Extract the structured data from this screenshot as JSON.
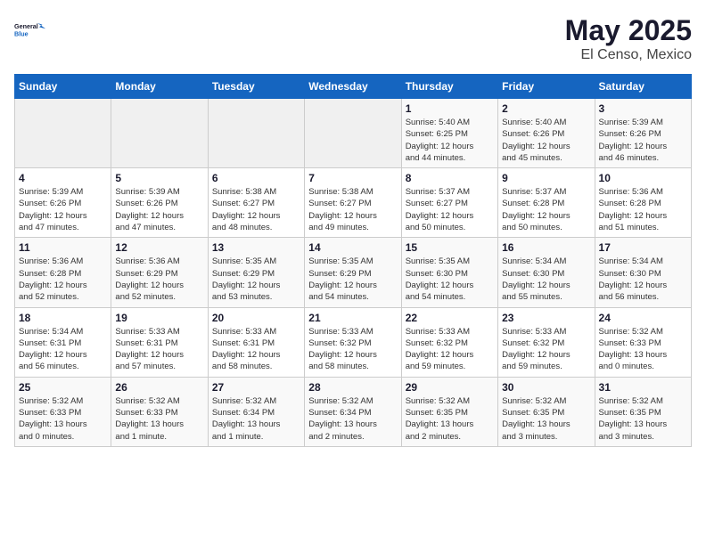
{
  "logo": {
    "line1": "General",
    "line2": "Blue"
  },
  "calendar": {
    "title": "May 2025",
    "subtitle": "El Censo, Mexico"
  },
  "weekdays": [
    "Sunday",
    "Monday",
    "Tuesday",
    "Wednesday",
    "Thursday",
    "Friday",
    "Saturday"
  ],
  "weeks": [
    [
      {
        "day": "",
        "info": ""
      },
      {
        "day": "",
        "info": ""
      },
      {
        "day": "",
        "info": ""
      },
      {
        "day": "",
        "info": ""
      },
      {
        "day": "1",
        "info": "Sunrise: 5:40 AM\nSunset: 6:25 PM\nDaylight: 12 hours\nand 44 minutes."
      },
      {
        "day": "2",
        "info": "Sunrise: 5:40 AM\nSunset: 6:26 PM\nDaylight: 12 hours\nand 45 minutes."
      },
      {
        "day": "3",
        "info": "Sunrise: 5:39 AM\nSunset: 6:26 PM\nDaylight: 12 hours\nand 46 minutes."
      }
    ],
    [
      {
        "day": "4",
        "info": "Sunrise: 5:39 AM\nSunset: 6:26 PM\nDaylight: 12 hours\nand 47 minutes."
      },
      {
        "day": "5",
        "info": "Sunrise: 5:39 AM\nSunset: 6:26 PM\nDaylight: 12 hours\nand 47 minutes."
      },
      {
        "day": "6",
        "info": "Sunrise: 5:38 AM\nSunset: 6:27 PM\nDaylight: 12 hours\nand 48 minutes."
      },
      {
        "day": "7",
        "info": "Sunrise: 5:38 AM\nSunset: 6:27 PM\nDaylight: 12 hours\nand 49 minutes."
      },
      {
        "day": "8",
        "info": "Sunrise: 5:37 AM\nSunset: 6:27 PM\nDaylight: 12 hours\nand 50 minutes."
      },
      {
        "day": "9",
        "info": "Sunrise: 5:37 AM\nSunset: 6:28 PM\nDaylight: 12 hours\nand 50 minutes."
      },
      {
        "day": "10",
        "info": "Sunrise: 5:36 AM\nSunset: 6:28 PM\nDaylight: 12 hours\nand 51 minutes."
      }
    ],
    [
      {
        "day": "11",
        "info": "Sunrise: 5:36 AM\nSunset: 6:28 PM\nDaylight: 12 hours\nand 52 minutes."
      },
      {
        "day": "12",
        "info": "Sunrise: 5:36 AM\nSunset: 6:29 PM\nDaylight: 12 hours\nand 52 minutes."
      },
      {
        "day": "13",
        "info": "Sunrise: 5:35 AM\nSunset: 6:29 PM\nDaylight: 12 hours\nand 53 minutes."
      },
      {
        "day": "14",
        "info": "Sunrise: 5:35 AM\nSunset: 6:29 PM\nDaylight: 12 hours\nand 54 minutes."
      },
      {
        "day": "15",
        "info": "Sunrise: 5:35 AM\nSunset: 6:30 PM\nDaylight: 12 hours\nand 54 minutes."
      },
      {
        "day": "16",
        "info": "Sunrise: 5:34 AM\nSunset: 6:30 PM\nDaylight: 12 hours\nand 55 minutes."
      },
      {
        "day": "17",
        "info": "Sunrise: 5:34 AM\nSunset: 6:30 PM\nDaylight: 12 hours\nand 56 minutes."
      }
    ],
    [
      {
        "day": "18",
        "info": "Sunrise: 5:34 AM\nSunset: 6:31 PM\nDaylight: 12 hours\nand 56 minutes."
      },
      {
        "day": "19",
        "info": "Sunrise: 5:33 AM\nSunset: 6:31 PM\nDaylight: 12 hours\nand 57 minutes."
      },
      {
        "day": "20",
        "info": "Sunrise: 5:33 AM\nSunset: 6:31 PM\nDaylight: 12 hours\nand 58 minutes."
      },
      {
        "day": "21",
        "info": "Sunrise: 5:33 AM\nSunset: 6:32 PM\nDaylight: 12 hours\nand 58 minutes."
      },
      {
        "day": "22",
        "info": "Sunrise: 5:33 AM\nSunset: 6:32 PM\nDaylight: 12 hours\nand 59 minutes."
      },
      {
        "day": "23",
        "info": "Sunrise: 5:33 AM\nSunset: 6:32 PM\nDaylight: 12 hours\nand 59 minutes."
      },
      {
        "day": "24",
        "info": "Sunrise: 5:32 AM\nSunset: 6:33 PM\nDaylight: 13 hours\nand 0 minutes."
      }
    ],
    [
      {
        "day": "25",
        "info": "Sunrise: 5:32 AM\nSunset: 6:33 PM\nDaylight: 13 hours\nand 0 minutes."
      },
      {
        "day": "26",
        "info": "Sunrise: 5:32 AM\nSunset: 6:33 PM\nDaylight: 13 hours\nand 1 minute."
      },
      {
        "day": "27",
        "info": "Sunrise: 5:32 AM\nSunset: 6:34 PM\nDaylight: 13 hours\nand 1 minute."
      },
      {
        "day": "28",
        "info": "Sunrise: 5:32 AM\nSunset: 6:34 PM\nDaylight: 13 hours\nand 2 minutes."
      },
      {
        "day": "29",
        "info": "Sunrise: 5:32 AM\nSunset: 6:35 PM\nDaylight: 13 hours\nand 2 minutes."
      },
      {
        "day": "30",
        "info": "Sunrise: 5:32 AM\nSunset: 6:35 PM\nDaylight: 13 hours\nand 3 minutes."
      },
      {
        "day": "31",
        "info": "Sunrise: 5:32 AM\nSunset: 6:35 PM\nDaylight: 13 hours\nand 3 minutes."
      }
    ]
  ]
}
